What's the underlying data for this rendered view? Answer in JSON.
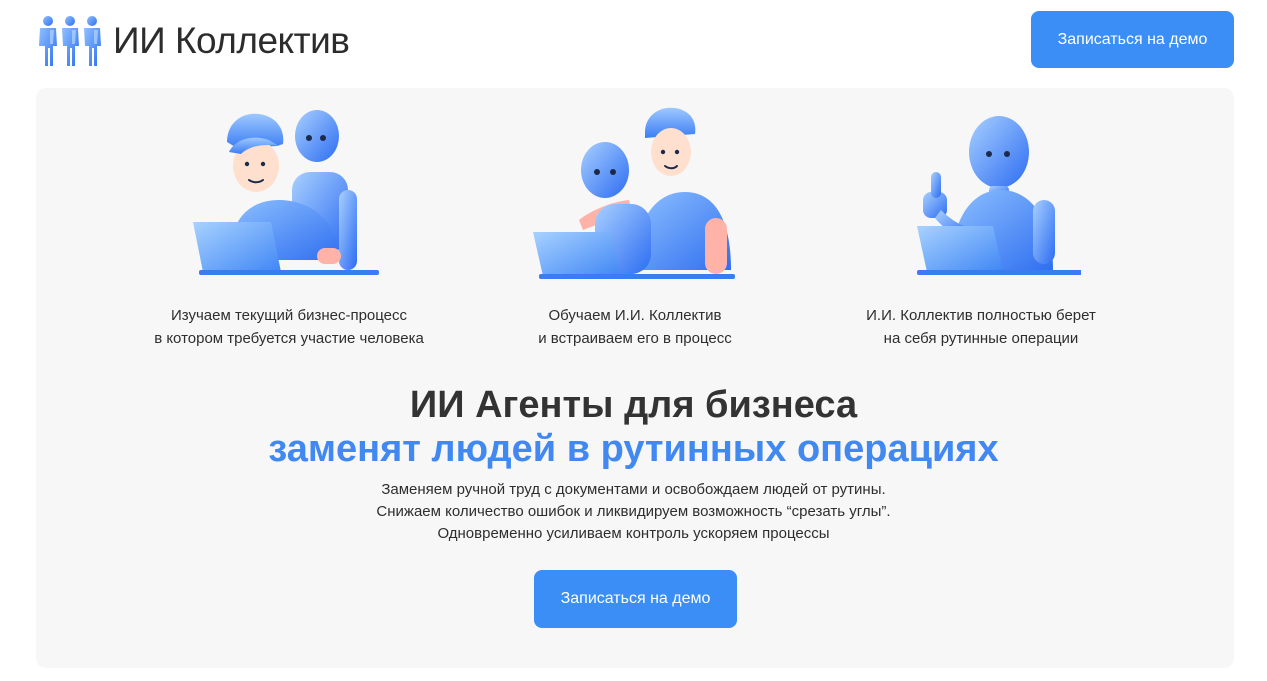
{
  "header": {
    "logo_icon": "three-people-logo-icon",
    "logo_text": "ИИ Коллектив",
    "cta_label": "Записаться на демо"
  },
  "colors": {
    "accent": "#3a8ef6",
    "highlight_text": "#4188f0",
    "card_background": "#f7f7f7"
  },
  "steps": [
    {
      "illustration": "person-and-robot-studying-icon",
      "caption_line1": "Изучаем текущий бизнес-процесс",
      "caption_line2": "в котором требуется участие человека"
    },
    {
      "illustration": "person-training-robot-icon",
      "caption_line1": "Обучаем И.И. Коллектив",
      "caption_line2": "и встраиваем его в процесс"
    },
    {
      "illustration": "robot-thumbs-up-icon",
      "caption_line1": "И.И. Коллектив полностью берет",
      "caption_line2": "на себя рутинные операции"
    }
  ],
  "hero": {
    "title_line1": "ИИ Агенты для бизнеса",
    "title_line2": "заменят людей в рутинных операциях",
    "desc_line1": "Заменяем ручной труд с документами и освобождаем людей от рутины.",
    "desc_line2": "Снижаем количество ошибок и ликвидируем возможность “срезать углы”.",
    "desc_line3": "Одновременно усиливаем контроль ускоряем процессы",
    "cta_label": "Записаться на демо"
  }
}
